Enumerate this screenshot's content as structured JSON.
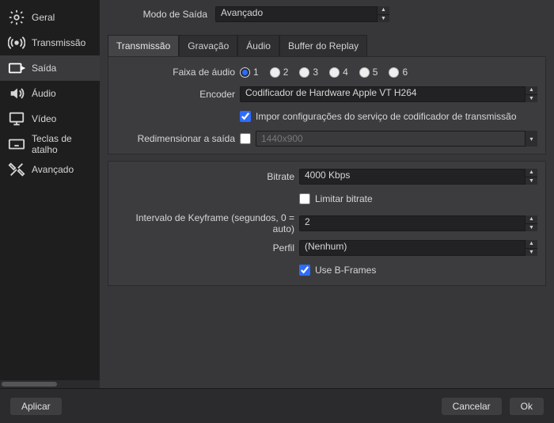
{
  "sidebar": {
    "items": [
      {
        "label": "Geral",
        "icon": "gear"
      },
      {
        "label": "Transmissão",
        "icon": "signal"
      },
      {
        "label": "Saída",
        "icon": "output"
      },
      {
        "label": "Áudio",
        "icon": "speaker"
      },
      {
        "label": "Vídeo",
        "icon": "monitor"
      },
      {
        "label": "Teclas de atalho",
        "icon": "keyboard"
      },
      {
        "label": "Avançado",
        "icon": "tools"
      }
    ],
    "selected_index": 2
  },
  "output_mode": {
    "label": "Modo de Saída",
    "value": "Avançado"
  },
  "tabs": {
    "items": [
      "Transmissão",
      "Gravação",
      "Áudio",
      "Buffer do Replay"
    ],
    "active_index": 0
  },
  "stream_panel": {
    "audio_track_label": "Faixa de áudio",
    "audio_tracks": [
      "1",
      "2",
      "3",
      "4",
      "5",
      "6"
    ],
    "audio_track_selected": 0,
    "encoder_label": "Encoder",
    "encoder_value": "Codificador de Hardware Apple VT H264",
    "enforce_checkbox": {
      "checked": true,
      "label": "Impor configurações do serviço de codificador de transmissão"
    },
    "rescale_label": "Redimensionar a saída",
    "rescale_checked": false,
    "rescale_value": "1440x900"
  },
  "encoder_panel": {
    "bitrate_label": "Bitrate",
    "bitrate_value": "4000 Kbps",
    "limit_bitrate": {
      "checked": false,
      "label": "Limitar bitrate"
    },
    "keyframe_label": "Intervalo de Keyframe (segundos, 0 = auto)",
    "keyframe_value": "2",
    "profile_label": "Perfil",
    "profile_value": "(Nenhum)",
    "bframes": {
      "checked": true,
      "label": "Use B-Frames"
    }
  },
  "footer": {
    "apply": "Aplicar",
    "cancel": "Cancelar",
    "ok": "Ok"
  }
}
